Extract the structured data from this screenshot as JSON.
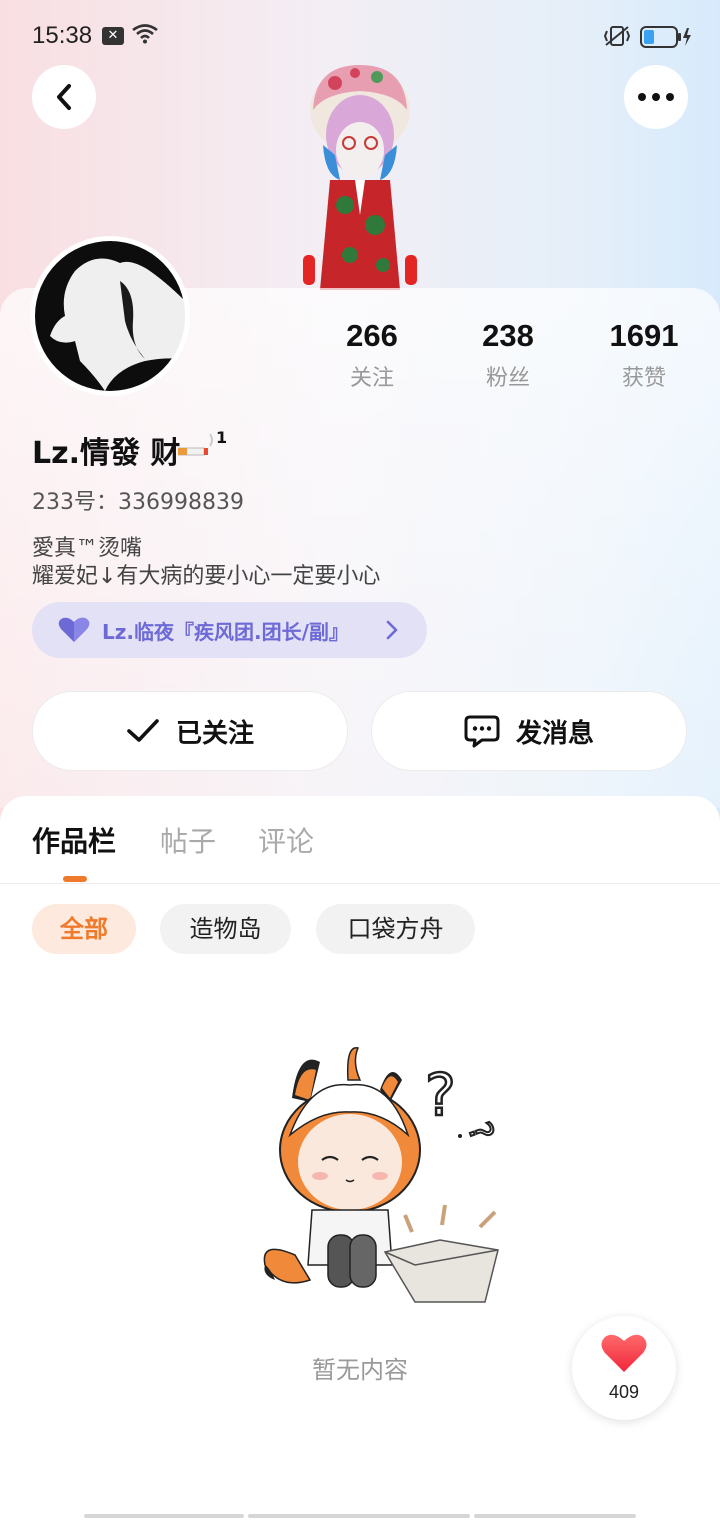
{
  "status_bar": {
    "time": "15:38",
    "notification_icon": "x-notification-icon",
    "icons": [
      "wifi-icon",
      "vibrate-icon",
      "battery-charging-icon"
    ]
  },
  "header": {
    "back_icon": "chevron-left-icon",
    "more_icon": "more-dots-icon"
  },
  "profile": {
    "stats": [
      {
        "value": "266",
        "label": "关注"
      },
      {
        "value": "238",
        "label": "粉丝"
      },
      {
        "value": "1691",
        "label": "获赞"
      }
    ],
    "name": "Lz.情發 财",
    "name_badge_number": "1",
    "uid": "233号：336998839",
    "bio_line1": "愛真™烫嘴",
    "bio_line2": "耀爱妃↓有大病的要小心一定要小心",
    "guild": {
      "label": "Lz.临夜『疾风团.团长/副』",
      "icon": "heart-icon",
      "color": "#6d6ad6"
    }
  },
  "actions": {
    "follow_label": "已关注",
    "message_label": "发消息"
  },
  "tabs": [
    {
      "label": "作品栏",
      "active": true
    },
    {
      "label": "帖子",
      "active": false
    },
    {
      "label": "评论",
      "active": false
    }
  ],
  "filters": [
    {
      "label": "全部",
      "selected": true
    },
    {
      "label": "造物岛",
      "selected": false
    },
    {
      "label": "口袋方舟",
      "selected": false
    }
  ],
  "empty_state": {
    "text": "暂无内容"
  },
  "like_widget": {
    "count": "409",
    "icon": "heart-icon"
  },
  "colors": {
    "accent": "#f07a2b",
    "guild_bg": "#e3e1f6",
    "chip_selected_bg": "#fde9dd"
  }
}
